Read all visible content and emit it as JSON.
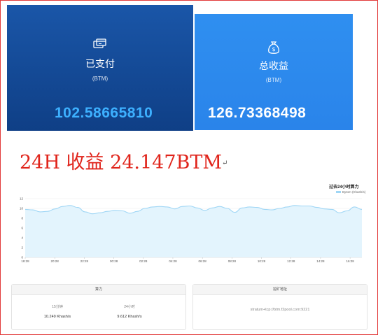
{
  "cards": {
    "paid": {
      "icon": "payment-card-icon",
      "title": "已支付",
      "unit": "(BTM)",
      "amount": "102.58665810"
    },
    "total": {
      "icon": "money-bag-icon",
      "title": "总收益",
      "unit": "(BTM)",
      "amount": "126.73368498"
    }
  },
  "headline": {
    "text": "24H 收益 24.147BTM",
    "return_mark": "↵"
  },
  "chart_data": {
    "type": "area",
    "title": "过去24小时算力",
    "legend": [
      "Bytom (Khash/s)"
    ],
    "legend_position": "top-right",
    "grid": true,
    "ylim": [
      0,
      12
    ],
    "y_ticks": [
      "0",
      "2",
      "4",
      "6",
      "8",
      "10",
      "12"
    ],
    "x_ticks": [
      "18:28",
      "20:28",
      "22:28",
      "00:28",
      "02:28",
      "04:28",
      "06:28",
      "08:28",
      "10:28",
      "12:28",
      "14:28",
      "16:28"
    ],
    "series": [
      {
        "name": "Bytom (Khash/s)",
        "color": "#9fd6f5",
        "values": [
          9.8,
          9.7,
          9.3,
          9.4,
          9.9,
          10.4,
          10.6,
          10.2,
          9.3,
          8.9,
          9.1,
          9.4,
          9.6,
          9.5,
          9.0,
          9.4,
          10.0,
          10.3,
          10.4,
          10.3,
          9.9,
          10.4,
          10.5,
          10.1,
          9.6,
          10.1,
          10.4,
          10.0,
          9.2,
          10.1,
          10.3,
          10.2,
          9.8,
          9.7,
          10.0,
          10.3,
          10.6,
          10.5,
          10.5,
          10.2,
          9.9,
          9.8,
          9.1,
          9.5,
          10.3,
          9.8
        ]
      }
    ]
  },
  "panels": {
    "hashrate": {
      "title": "算力",
      "stat_15": {
        "label": "15分钟",
        "value": "10.249 Khash/s"
      },
      "stat_24": {
        "label": "24小时",
        "value": "9.612 Khash/s"
      }
    },
    "address": {
      "title": "挖矿地址",
      "value": "stratum+tcp://btm.f2pool.com:9221"
    }
  }
}
